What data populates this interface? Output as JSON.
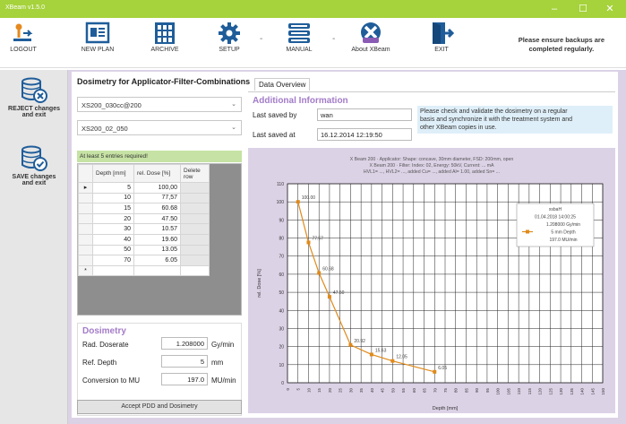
{
  "app": {
    "title": "XBeam v1.5.0",
    "notice": [
      "Please ensure backups are",
      "completed regularly."
    ]
  },
  "window_controls": {
    "minimize": "–",
    "maximize": "☐",
    "close": "✕"
  },
  "toolbar": {
    "logout": "LOGOUT",
    "new_plan": "NEW PLAN",
    "archive": "ARCHIVE",
    "setup": "SETUP",
    "manual": "MANUAL",
    "about": "About XBeam",
    "exit": "EXIT",
    "separator": "-"
  },
  "sidebar": {
    "reject_label": [
      "REJECT changes",
      "and exit"
    ],
    "save_label": [
      "SAVE changes",
      "and exit"
    ]
  },
  "left_panel": {
    "heading": "Dosimetry for Applicator-Filter-Combinations",
    "applicator_select": "XS200_030cc@200",
    "filter_select": "XS200_02_050",
    "table_notice": "At least 5 entries required!",
    "table": {
      "headers": [
        "Depth [mm]",
        "rel. Dose [%]",
        "Delete row"
      ],
      "rows": [
        {
          "marker": "▸",
          "depth": "5",
          "dose": "100,00"
        },
        {
          "marker": "",
          "depth": "10",
          "dose": "77,57"
        },
        {
          "marker": "",
          "depth": "15",
          "dose": "60.68"
        },
        {
          "marker": "",
          "depth": "20",
          "dose": "47.50"
        },
        {
          "marker": "",
          "depth": "30",
          "dose": "10.57"
        },
        {
          "marker": "",
          "depth": "40",
          "dose": "19.60"
        },
        {
          "marker": "",
          "depth": "50",
          "dose": "13.05"
        },
        {
          "marker": "",
          "depth": "70",
          "dose": "6.05"
        },
        {
          "marker": "*",
          "depth": "",
          "dose": ""
        }
      ]
    },
    "dosimetry": {
      "title": "Dosimetry",
      "rad_doserate_label": "Rad. Doserate",
      "rad_doserate_value": "1.208000",
      "rad_doserate_unit": "Gy/min",
      "ref_depth_label": "Ref. Depth",
      "ref_depth_value": "5",
      "ref_depth_unit": "mm",
      "conversion_label": "Conversion to MU",
      "conversion_value": "197.0",
      "conversion_unit": "MU/min",
      "accept_button": "Accept PDD and Dosimetry"
    }
  },
  "right_panel": {
    "tab": "Data Overview",
    "additional_title": "Additional Information",
    "last_saved_by_label": "Last saved by",
    "last_saved_by_value": "wan",
    "last_saved_at_label": "Last saved at",
    "last_saved_at_value": "16.12.2014 12:19:50",
    "info_text": [
      "Please check and validate the dosimetry on a regular",
      "basis and synchronize it with the treatment system and",
      "other XBeam copies in use."
    ]
  },
  "chart_data": {
    "type": "line",
    "header_lines": [
      "X Beam 200 · Applicator: Shape: concave, 30mm diameter, FSD: 200mm, open",
      "X Beam 200 · Filter: Index: 02, Energy: 50kV, Current: ... mA",
      "HVL1= ..., HVL2= ..., added Cu= ..., added Al= 1.00, added Sn= ..."
    ],
    "xlabel": "Depth [mm]",
    "ylabel": "rel. Dose [%]",
    "xlim": [
      0,
      150
    ],
    "ylim": [
      0,
      110
    ],
    "xticks": [
      "0",
      "5",
      "10",
      "15",
      "20",
      "25",
      "30",
      "35",
      "40",
      "45",
      "50",
      "55",
      "60",
      "65",
      "70",
      "75",
      "80",
      "85",
      "90",
      "95",
      "100",
      "105",
      "110",
      "115",
      "120",
      "125",
      "130",
      "135",
      "140",
      "145",
      "150"
    ],
    "yticks": [
      "0",
      "10",
      "20",
      "30",
      "40",
      "50",
      "60",
      "70",
      "80",
      "90",
      "100",
      "110"
    ],
    "grid": true,
    "series": [
      {
        "x": [
          5,
          10,
          15,
          20,
          30,
          40,
          50,
          70
        ],
        "y": [
          100.0,
          77.57,
          60.68,
          47.5,
          20.92,
          15.63,
          12.05,
          6.05
        ],
        "labels": [
          "100.00",
          "77.57",
          "60.68",
          "47.50",
          "20.92",
          "15.63",
          "12.05",
          "6.05"
        ],
        "color": "#e08a1a"
      }
    ],
    "legend": {
      "placement": "top-right",
      "lines": [
        "xsbaH",
        "01.04.2018 14:00:25",
        "1.208000 Gy/min",
        "5 mm Depth",
        "197.0 MU/min"
      ]
    }
  }
}
